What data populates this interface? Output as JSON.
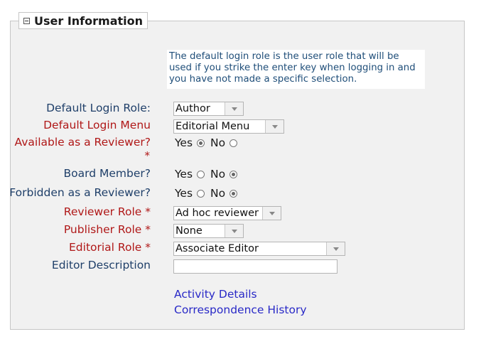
{
  "section": {
    "title": "User Information",
    "info_text": "The default login role is the user role that will be used if you strike the enter key when logging in and you have not made a specific selection."
  },
  "fields": {
    "default_login_role": {
      "label": "Default Login Role:",
      "value": "Author"
    },
    "default_login_menu": {
      "label": "Default Login Menu",
      "value": "Editorial Menu"
    },
    "available_reviewer": {
      "label": "Available as a Reviewer?",
      "required": "*",
      "yes": "Yes",
      "no": "No",
      "selected": "Yes"
    },
    "board_member": {
      "label": "Board Member?",
      "yes": "Yes",
      "no": "No",
      "selected": "No"
    },
    "forbidden_reviewer": {
      "label": "Forbidden as a Reviewer?",
      "yes": "Yes",
      "no": "No",
      "selected": "No"
    },
    "reviewer_role": {
      "label": "Reviewer Role  *",
      "value": "Ad hoc reviewer"
    },
    "publisher_role": {
      "label": "Publisher Role  *",
      "value": "None"
    },
    "editorial_role": {
      "label": "Editorial Role  *",
      "value": "Associate Editor"
    },
    "editor_description": {
      "label": "Editor Description",
      "value": ""
    }
  },
  "links": {
    "activity_details": "Activity Details",
    "correspondence_history": "Correspondence History"
  },
  "icons": {
    "collapse": "collapse-minus-icon",
    "dropdown": "chevron-down-icon"
  },
  "colors": {
    "label_blue": "#1f3f69",
    "label_red": "#b01818",
    "link": "#2929c7",
    "panel_bg": "#f1f1f1"
  }
}
